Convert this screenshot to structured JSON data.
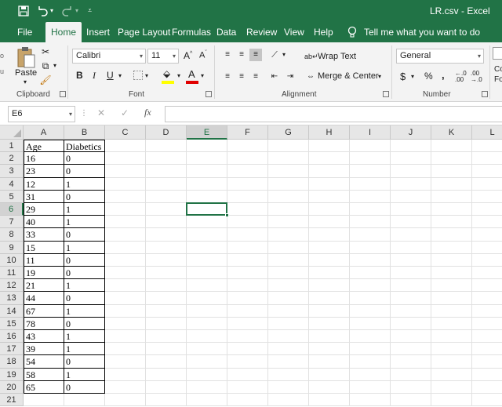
{
  "titlebar": {
    "title": "LR.csv  -  Excel"
  },
  "tabs": [
    "File",
    "Home",
    "Insert",
    "Page Layout",
    "Formulas",
    "Data",
    "Review",
    "View",
    "Help"
  ],
  "tellme": "Tell me what you want to do",
  "ribbon": {
    "clipboard": {
      "paste_label": "Paste",
      "group_label": "Clipboard"
    },
    "font": {
      "font_name": "Calibri",
      "font_size": "11",
      "group_label": "Font"
    },
    "alignment": {
      "wrap_text": "Wrap Text",
      "merge_center": "Merge & Center",
      "group_label": "Alignment"
    },
    "number": {
      "format": "General",
      "group_label": "Number"
    },
    "styles_partial": "Co\nFo"
  },
  "formula_bar": {
    "name_box": "E6",
    "formula": ""
  },
  "sheet": {
    "columns": [
      "A",
      "B",
      "C",
      "D",
      "E",
      "F",
      "G",
      "H",
      "I",
      "J",
      "K",
      "L"
    ],
    "rows": [
      "1",
      "2",
      "3",
      "4",
      "5",
      "6",
      "7",
      "8",
      "9",
      "10",
      "11",
      "12",
      "13",
      "14",
      "15",
      "16",
      "17",
      "18",
      "19",
      "20",
      "21"
    ],
    "selected_cell": "E6",
    "table": {
      "headers": [
        "Age",
        "Diabetics"
      ],
      "data": [
        [
          "16",
          "0"
        ],
        [
          "23",
          "0"
        ],
        [
          "12",
          "1"
        ],
        [
          "31",
          "0"
        ],
        [
          "29",
          "1"
        ],
        [
          "40",
          "1"
        ],
        [
          "33",
          "0"
        ],
        [
          "15",
          "1"
        ],
        [
          "11",
          "0"
        ],
        [
          "19",
          "0"
        ],
        [
          "21",
          "1"
        ],
        [
          "44",
          "0"
        ],
        [
          "67",
          "1"
        ],
        [
          "78",
          "0"
        ],
        [
          "43",
          "1"
        ],
        [
          "39",
          "1"
        ],
        [
          "54",
          "0"
        ],
        [
          "58",
          "1"
        ],
        [
          "65",
          "0"
        ]
      ]
    }
  },
  "colors": {
    "excel_green": "#217346",
    "ribbon_bg": "#f3f3f3",
    "font_color_bar": "#e00000",
    "highlight_bar": "#ffff00"
  }
}
